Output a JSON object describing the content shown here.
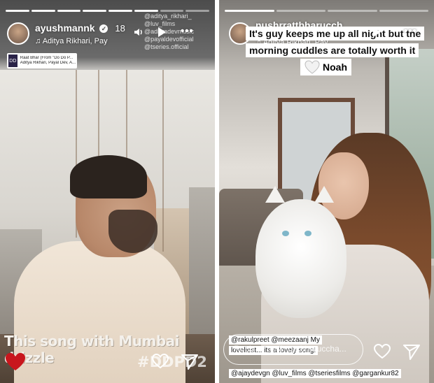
{
  "left_story": {
    "username": "ayushmannk",
    "time_ago": "18",
    "subtitle": "Aditya Rikhari, Pay",
    "music_sticker": {
      "title": "Raat Bhar (From \"Do Do P...",
      "artists": "Aditya Rikhari, Payal Dev, A..."
    },
    "mentions": [
      "@aditya_rikhari_",
      "@luv_films",
      "@adityadevmusic",
      "@payaldevofficial",
      "@tseries.official"
    ],
    "caption": "This song with Mumbai drizzle",
    "hashtag": "#DDPD2",
    "icons": [
      "volume-icon",
      "play-icon",
      "more-icon",
      "verified-icon",
      "heart-icon",
      "send-icon",
      "red-heart-emoji"
    ]
  },
  "right_story": {
    "username": "nushrrattbharucch",
    "subtitle": "Aditya Rikhari, Pay",
    "sticker_lines": [
      "It's guy keeps me up all night but the",
      "morning cuddles are totally worth it"
    ],
    "sticker_name": "Noah",
    "tag_lines": [
      "@rakulpreet @meezaanj My",
      "loveliest... its a lovely song!"
    ],
    "tag_line_bottom": "@ajaydevgn @luv_films @tseriesfilms @gargankur82",
    "reply_placeholder": "Reply to",
    "reply_handle": "nushrrattbharuccha...",
    "icons": [
      "volume-icon",
      "play-icon",
      "more-icon",
      "heart-icon",
      "send-icon",
      "white-heart-emoji"
    ]
  },
  "colors": {
    "red_heart": "#c8161d",
    "text_white": "#ffffff"
  }
}
